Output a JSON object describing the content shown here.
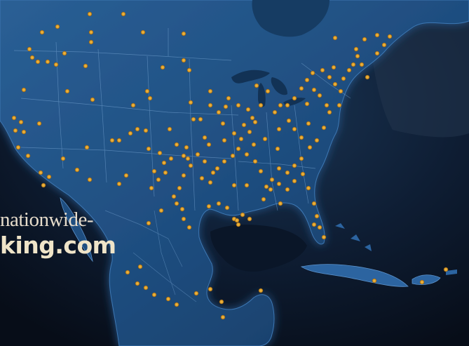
{
  "headline": {
    "line1": "nationwide-",
    "line2": "king.com"
  },
  "colors": {
    "ocean": "#0b1626",
    "land": "#1b4a78",
    "land_glow": "#2f6aa6",
    "border": "#6f9cc8",
    "dot": "#e5a52b",
    "text": "#e9dfc9"
  }
}
